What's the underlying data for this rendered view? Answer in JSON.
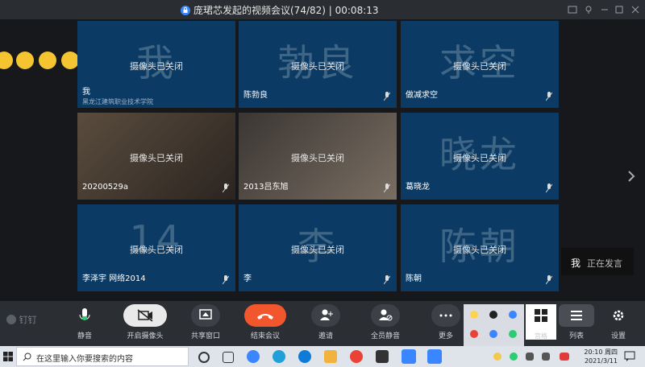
{
  "window": {
    "title": "庞珺芯发起的视频会议(74/82) | 00:08:13"
  },
  "tiles": [
    {
      "big": "我",
      "cam": "摄像头已关闭",
      "name": "我",
      "org": "黑龙江建筑职业技术学院"
    },
    {
      "big": "勃良",
      "cam": "摄像头已关闭",
      "name": "陈勃良"
    },
    {
      "big": "求空",
      "cam": "摄像头已关闭",
      "name": "做减求空"
    },
    {
      "big": "",
      "cam": "摄像头已关闭",
      "name": "20200529a"
    },
    {
      "big": "",
      "cam": "摄像头已关闭",
      "name": "2013吕东旭"
    },
    {
      "big": "晓龙",
      "cam": "摄像头已关闭",
      "name": "葛晓龙"
    },
    {
      "big": "14",
      "cam": "摄像头已关闭",
      "name": "李泽宇 网络2014"
    },
    {
      "big": "李",
      "cam": "摄像头已关闭",
      "name": "李"
    },
    {
      "big": "陈朝",
      "cam": "摄像头已关闭",
      "name": "陈朝"
    }
  ],
  "speaking": {
    "me": "我",
    "text": "正在发言"
  },
  "toolbar": {
    "logo": "钉钉",
    "mute": "静音",
    "camera": "开启摄像头",
    "share": "共享窗口",
    "end": "结束会议",
    "invite": "邀请",
    "mute_all": "全员静音",
    "more": "更多",
    "grid_view": "宫格",
    "list_view": "列表",
    "settings": "设置"
  },
  "taskbar": {
    "search_placeholder": "在这里输入你要搜索的内容",
    "time": "20:10 周四",
    "date": "2021/3/11"
  },
  "colors": {
    "tile_bg": "#0b3b64",
    "end_button": "#f2562d",
    "toolbar_bg": "#2b2e33"
  }
}
